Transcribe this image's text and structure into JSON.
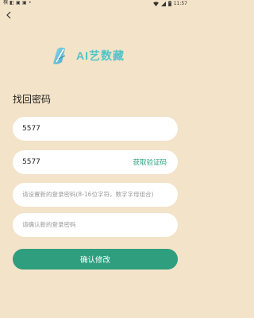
{
  "status_bar": {
    "left_glyphs": [
      "㯢",
      "◧",
      "▣",
      "▣",
      "•"
    ],
    "time": "11:57"
  },
  "logo": {
    "text": "AI艺数藏",
    "icon": "brush-leaf-logo"
  },
  "page": {
    "title": "找回密码"
  },
  "form": {
    "phone": {
      "value": "5577",
      "placeholder": ""
    },
    "code": {
      "value": "5577",
      "placeholder": "",
      "get_code_label": "获取验证码"
    },
    "new_password": {
      "value": "",
      "placeholder": "请设置新的登录密码(8-16位字符，数字字母组合)"
    },
    "confirm_password": {
      "value": "",
      "placeholder": "请确认新的登录密码"
    }
  },
  "actions": {
    "confirm_label": "确认修改"
  },
  "colors": {
    "background": "#f3e3c8",
    "accent_green": "#2f9e7f",
    "logo_teal": "#52c3c8"
  }
}
